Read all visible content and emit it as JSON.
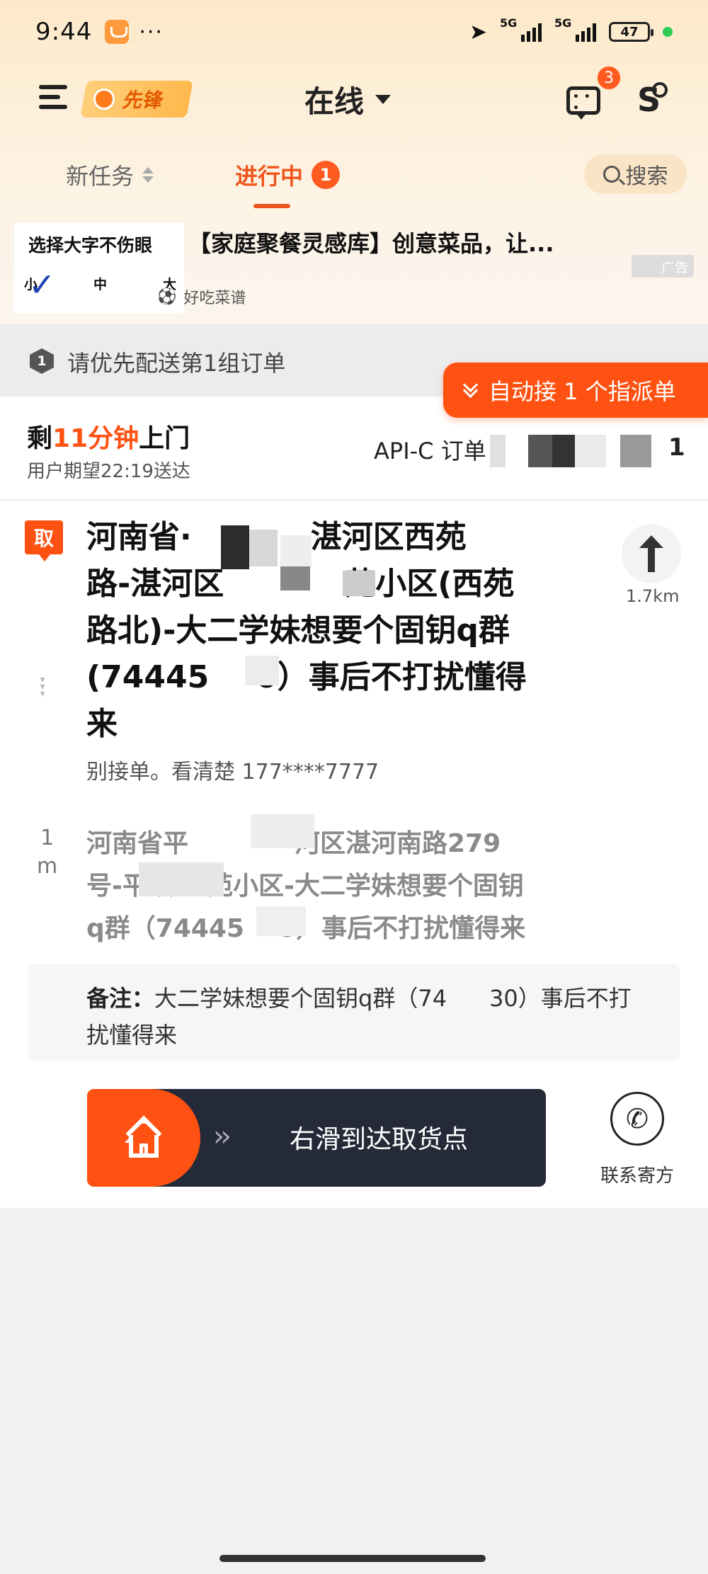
{
  "status_bar": {
    "time": "9:44",
    "dots": "···",
    "signal1": "5G",
    "signal2": "5G",
    "battery": "47"
  },
  "header": {
    "brand_label": "先锋",
    "status_label": "在线",
    "message_count": "3"
  },
  "tabs": {
    "new_task": "新任务",
    "in_progress": "进行中",
    "in_progress_count": "1",
    "search": "搜索"
  },
  "ad": {
    "image_title": "选择大字不伤眼",
    "image_sizes": [
      "小",
      "中",
      "大"
    ],
    "title": "【家庭聚餐灵感库】创意菜品，让...",
    "source": "好吃菜谱",
    "tag": "广告"
  },
  "notice": {
    "group_num": "1",
    "text": "请优先配送第1组订单"
  },
  "auto_accept": "自动接 1 个指派单",
  "order": {
    "remain_prefix": "剩",
    "remain_time": "11分钟",
    "remain_suffix": "上门",
    "expect": "用户期望22:19送达",
    "api_label": "API-C 订单",
    "index": "1",
    "pick_tag": "取",
    "pick_address_l1": "河南省·",
    "pick_address_l1b": "湛河区西苑",
    "pick_address_l2": "路-湛河区",
    "pick_address_l2b": "苑小区(西苑",
    "pick_address_l3": "路北)-大二学妹想要个固钥q群",
    "pick_address_l4": "(74445",
    "pick_address_l4b": "0）事后不打扰懂得",
    "pick_address_l5": "来",
    "contact": "别接单。看清楚 177****7777",
    "distance_pick": "1.7km",
    "distance_drop": "1\nm",
    "drop_address_l1": "河南省平",
    "drop_address_l1b": "河区湛河南路279",
    "drop_address_l2": "号-平顶",
    "drop_address_l2b": "苑小区-大二学妹想要个固钥",
    "drop_address_l3": "q群（74445",
    "drop_address_l3b": "0）事后不打扰懂得来",
    "note_label": "备注：",
    "note_text": "大二学妹想要个固钥q群（74",
    "note_text_b": "30）事后不打扰懂得来",
    "slide_text": "右滑到达取货点",
    "contact_sender": "联系寄方"
  }
}
